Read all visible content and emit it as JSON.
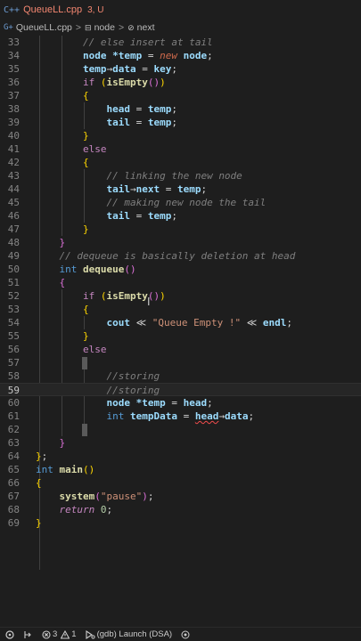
{
  "tab": {
    "icon": "C++",
    "filename": "QueueLL.cpp",
    "status": "3, U"
  },
  "breadcrumb": {
    "file": "QueueLL.cpp",
    "sep": ">",
    "class": "node",
    "member": "next"
  },
  "editor": {
    "line_numbers": [
      "33",
      "34",
      "35",
      "36",
      "37",
      "38",
      "39",
      "40",
      "41",
      "42",
      "43",
      "44",
      "45",
      "46",
      "47",
      "48",
      "49",
      "50",
      "51",
      "52",
      "53",
      "54",
      "55",
      "56",
      "57",
      "58",
      "59",
      "60",
      "61",
      "62",
      "63",
      "64",
      "65",
      "66",
      "67",
      "68",
      "69"
    ],
    "active_line": "59"
  },
  "statusbar": {
    "remote_icon": "remote-icon",
    "errors": "3",
    "warnings": "1",
    "debug_label": "(gdb) Launch (DSA)"
  }
}
